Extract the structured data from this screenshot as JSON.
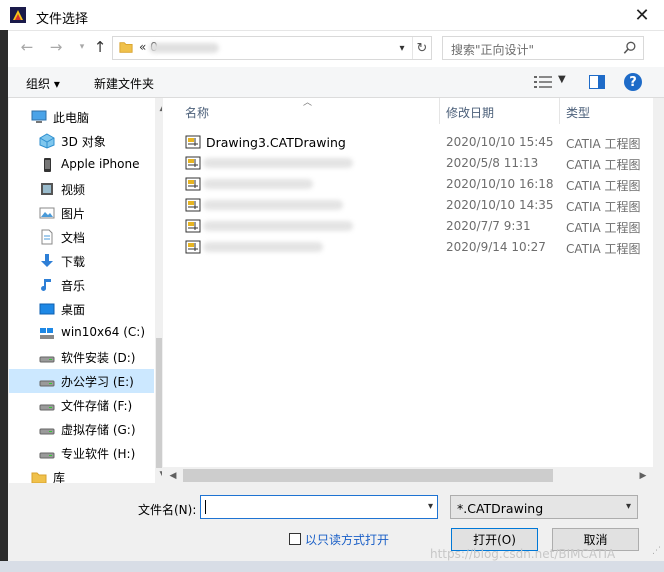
{
  "window": {
    "title": "文件选择",
    "close_glyph": "✕"
  },
  "address": {
    "path": "« 0"
  },
  "search": {
    "placeholder": "搜索\"正向设计\""
  },
  "toolbar": {
    "organize": "组织 ▾",
    "new_folder": "新建文件夹"
  },
  "nav": {
    "items": [
      {
        "label": "此电脑",
        "icon": "computer-icon",
        "indent": 0
      },
      {
        "label": "3D 对象",
        "icon": "cube-icon",
        "indent": 1
      },
      {
        "label": "Apple iPhone",
        "icon": "phone-icon",
        "indent": 1
      },
      {
        "label": "视频",
        "icon": "video-icon",
        "indent": 1
      },
      {
        "label": "图片",
        "icon": "picture-icon",
        "indent": 1
      },
      {
        "label": "文档",
        "icon": "document-icon",
        "indent": 1
      },
      {
        "label": "下载",
        "icon": "download-icon",
        "indent": 1
      },
      {
        "label": "音乐",
        "icon": "music-icon",
        "indent": 1
      },
      {
        "label": "桌面",
        "icon": "desktop-icon",
        "indent": 1
      },
      {
        "label": "win10x64 (C:)",
        "icon": "windows-drive-icon",
        "indent": 1
      },
      {
        "label": "软件安装 (D:)",
        "icon": "drive-icon",
        "indent": 1
      },
      {
        "label": "办公学习 (E:)",
        "icon": "drive-icon",
        "indent": 1,
        "selected": true
      },
      {
        "label": "文件存储 (F:)",
        "icon": "drive-icon",
        "indent": 1
      },
      {
        "label": "虚拟存储 (G:)",
        "icon": "drive-icon",
        "indent": 1
      },
      {
        "label": "专业软件 (H:)",
        "icon": "drive-icon",
        "indent": 1
      },
      {
        "label": "库",
        "icon": "library-icon",
        "indent": 0
      }
    ]
  },
  "columns": {
    "name": "名称",
    "date": "修改日期",
    "type": "类型"
  },
  "files": [
    {
      "name": "Drawing3.CATDrawing",
      "date": "2020/10/10 15:45",
      "type": "CATIA 工程图"
    },
    {
      "name": "",
      "date": "2020/5/8 11:13",
      "type": "CATIA 工程图"
    },
    {
      "name": "",
      "date": "2020/10/10 16:18",
      "type": "CATIA 工程图"
    },
    {
      "name": "",
      "date": "2020/10/10 14:35",
      "type": "CATIA 工程图"
    },
    {
      "name": "",
      "date": "2020/7/7 9:31",
      "type": "CATIA 工程图"
    },
    {
      "name": "",
      "date": "2020/9/14 10:27",
      "type": "CATIA 工程图"
    }
  ],
  "bottom": {
    "filename_label": "文件名(N):",
    "filename_value": "",
    "filetype": "*.CATDrawing",
    "readonly_label": "以只读方式打开",
    "open_label": "打开(O)",
    "cancel_label": "取消"
  },
  "watermark": "https://blog.csdn.net/BIMCATIA",
  "colors": {
    "accent": "#0078d7",
    "selection": "#cce8ff",
    "link": "#1a5fc7"
  }
}
